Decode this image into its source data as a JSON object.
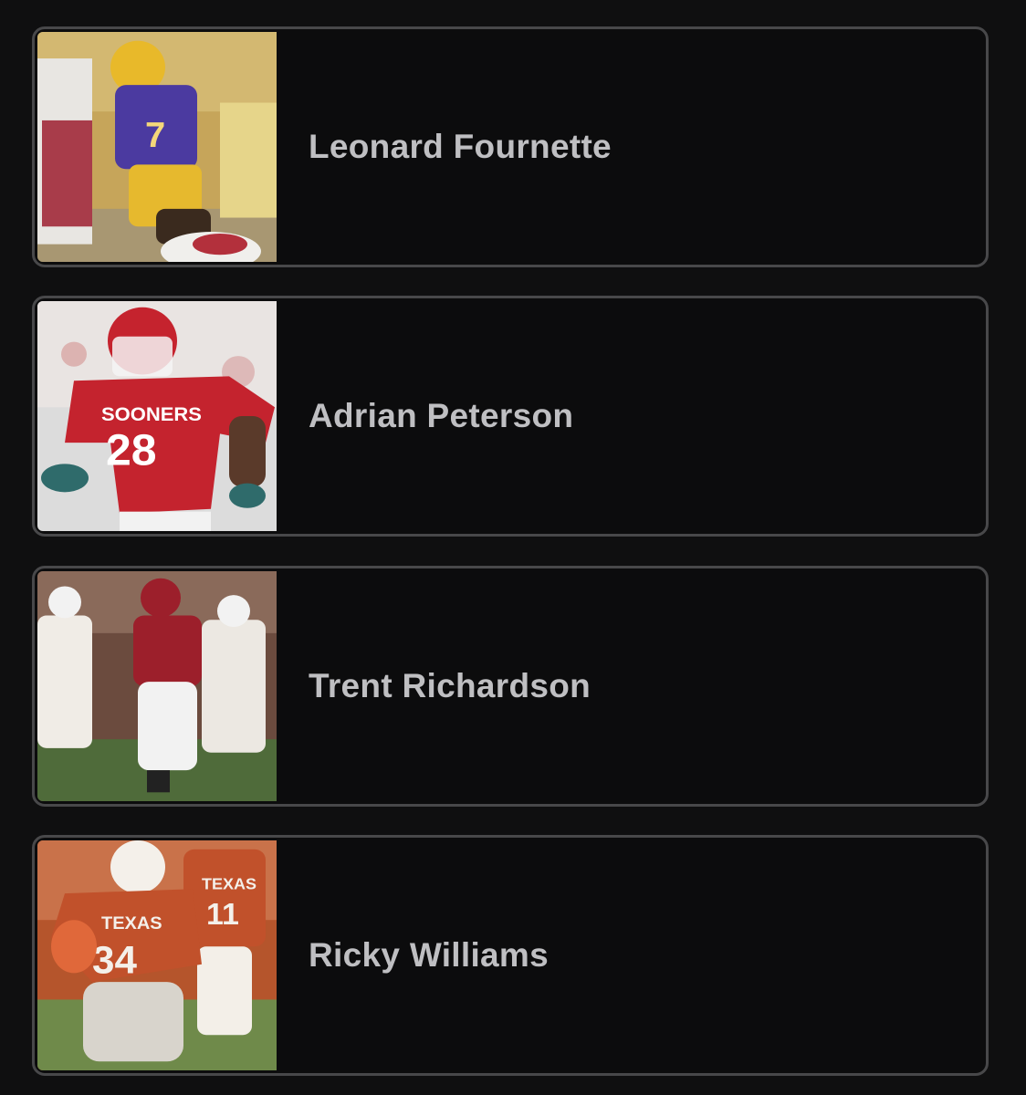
{
  "players": [
    {
      "name": "Leonard Fournette",
      "photo_icon": "player-photo-lsu",
      "colors": {
        "jersey": "#4b3a9a",
        "trim": "#e6b92e",
        "background": "#c9a84a"
      }
    },
    {
      "name": "Adrian Peterson",
      "photo_icon": "player-photo-oklahoma",
      "jersey_text": "SOONERS",
      "jersey_number": "28",
      "colors": {
        "jersey": "#c4232e",
        "trim": "#ffffff",
        "background": "#d9d9d9"
      }
    },
    {
      "name": "Trent Richardson",
      "photo_icon": "player-photo-alabama",
      "colors": {
        "jersey": "#9c1f2b",
        "trim": "#f2f2f2",
        "background": "#6d4b3e"
      }
    },
    {
      "name": "Ricky Williams",
      "photo_icon": "player-photo-texas",
      "jersey_text": "TEXAS",
      "jersey_number": "34",
      "colors": {
        "jersey": "#c1512b",
        "trim": "#f4f0ea",
        "background": "#b5552c"
      }
    }
  ]
}
